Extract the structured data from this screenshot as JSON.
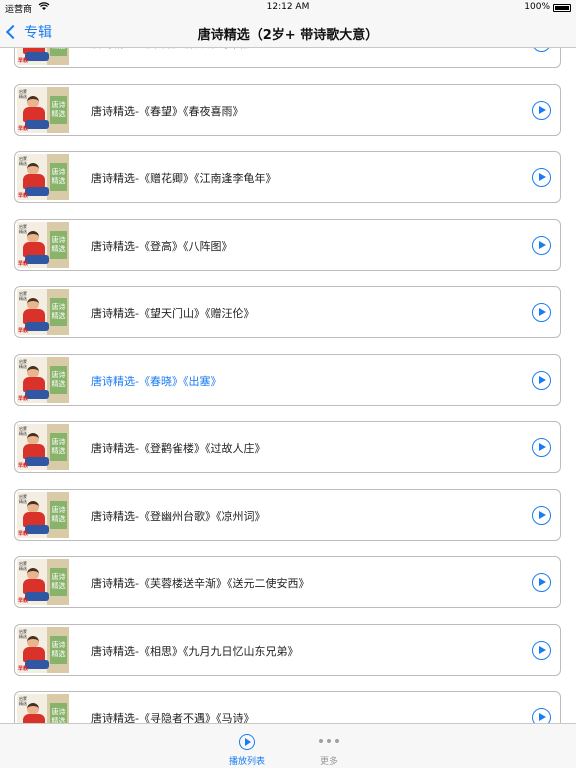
{
  "status_bar": {
    "carrier": "运营商",
    "time": "12:12 AM",
    "battery": "100%"
  },
  "nav": {
    "back_label": "专辑",
    "title": "唐诗精选（2岁+ 带诗歌大意）"
  },
  "thumbnail": {
    "tag_line1": "启蒙",
    "tag_line2": "精选",
    "sign_text": "唐诗精选",
    "badge": "早教"
  },
  "items": [
    {
      "title": "唐诗精选-《早梅》《春日忆李白》"
    },
    {
      "title": "唐诗精选-《春望》《春夜喜雨》"
    },
    {
      "title": "唐诗精选-《赠花卿》《江南逢李龟年》"
    },
    {
      "title": "唐诗精选-《登高》《八阵图》"
    },
    {
      "title": "唐诗精选-《望天门山》《赠汪伦》"
    },
    {
      "title": "唐诗精选-《春晓》《出塞》"
    },
    {
      "title": "唐诗精选-《登鹳雀楼》《过故人庄》"
    },
    {
      "title": "唐诗精选-《登幽州台歌》《凉州词》"
    },
    {
      "title": "唐诗精选-《芙蓉楼送辛渐》《送元二使安西》"
    },
    {
      "title": "唐诗精选-《相思》《九月九日忆山东兄弟》"
    },
    {
      "title": "唐诗精选-《寻隐者不遇》《马诗》"
    }
  ],
  "active_index": 5,
  "tabs": [
    {
      "label": "播放列表",
      "icon": "play-circle-icon",
      "selected": true
    },
    {
      "label": "更多",
      "icon": "more-dots-icon",
      "selected": false
    }
  ],
  "colors": {
    "accent": "#1a7cf3",
    "inactive": "#9a9a9a"
  }
}
